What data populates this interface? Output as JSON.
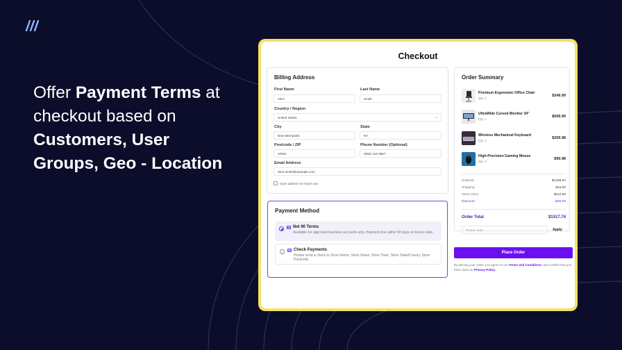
{
  "hero": {
    "line1_a": "Offer ",
    "line1_b": "Payment Terms",
    "line1_c": " at",
    "line2": "checkout based on",
    "line3": "Customers, User",
    "line4": "Groups, Geo - Location"
  },
  "checkout": {
    "title": "Checkout",
    "billing": {
      "title": "Billing Address",
      "first_name_label": "First Name",
      "first_name_value": "Alice",
      "last_name_label": "Last Name",
      "last_name_value": "Smith",
      "country_label": "Country / Region",
      "country_value": "United States",
      "city_label": "City",
      "city_value": "New Metropolis",
      "state_label": "State",
      "state_value": "NY",
      "postcode_label": "Postcode / ZIP",
      "postcode_value": "10001",
      "phone_label": "Phone Number (Optional)",
      "phone_value": "(555) 123-4567",
      "email_label": "Email Address",
      "email_value": "alice.smith@example.com",
      "save_label": "Save address for future use"
    },
    "payment": {
      "title": "Payment Method",
      "options": [
        {
          "name": "Net 90 Terms",
          "desc": "Available for approved business accounts only. Payment due within 90 days of invoice date."
        },
        {
          "name": "Check Payments",
          "desc": "Please send a check to Store Name, Store Street, Store Town, Store State/County, Store Postcode."
        }
      ]
    },
    "summary": {
      "title": "Order Summary",
      "items": [
        {
          "name": "Premium Ergonomic Office Chair",
          "qty": "Qty: 1",
          "price": "$349.99"
        },
        {
          "name": "UltraWide Curved Monitor 34\"",
          "qty": "Qty: 1",
          "price": "$699.99"
        },
        {
          "name": "Wireless Mechanical Keyboard",
          "qty": "Qty: 2",
          "price": "$259.98"
        },
        {
          "name": "High-Precision Gaming Mouse",
          "qty": "Qty: 2",
          "price": "$99.98"
        }
      ],
      "subtotal_label": "Subtotal",
      "subtotal_value": "$1409.94",
      "shipping_label": "Shipping",
      "shipping_value": "$15.00",
      "taxes_label": "Taxes (8%)",
      "taxes_value": "$112.80",
      "discount_label": "Discount",
      "discount_value": "-$20.00",
      "total_label": "Order Total",
      "total_value": "$1517.74",
      "promo_placeholder": "Promo code",
      "apply_label": "Apply"
    },
    "place_order_label": "Place Order",
    "terms": {
      "pre": "By placing your order, you agree to our ",
      "link1": "Terms and Conditions",
      "mid": ", and confirm that you have read our ",
      "link2": "Privacy Policy",
      "post": "."
    }
  },
  "colors": {
    "background": "#0b0d2a",
    "frame": "#f4e06a",
    "accent": "#6a10f0",
    "logo": "#8fb6ff"
  }
}
